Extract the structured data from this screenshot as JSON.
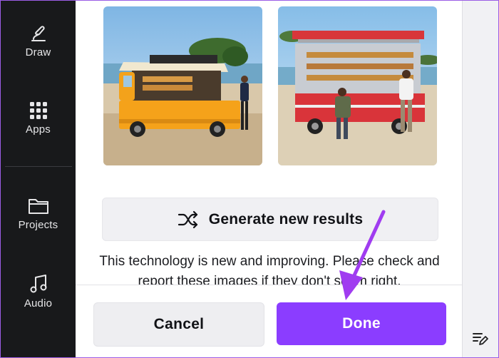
{
  "sidebar": {
    "items": [
      {
        "label": "Draw",
        "icon": "pen-icon"
      },
      {
        "label": "Apps",
        "icon": "grid-icon"
      },
      {
        "label": "Projects",
        "icon": "folder-icon"
      },
      {
        "label": "Audio",
        "icon": "music-note-icon"
      }
    ]
  },
  "results": {
    "images": [
      {
        "subject": "yellow food truck on beach",
        "icon": "image-thumbnail"
      },
      {
        "subject": "red food truck on beach",
        "icon": "image-thumbnail"
      }
    ],
    "generate_label": "Generate new results",
    "generate_icon": "shuffle-icon",
    "disclaimer": "This technology is new and improving. Please check and report these images if they don't seem right."
  },
  "footer": {
    "cancel_label": "Cancel",
    "done_label": "Done"
  },
  "colors": {
    "accent": "#8b3dff",
    "sidebar_bg": "#18191b",
    "annotation_arrow": "#a03cf0"
  }
}
